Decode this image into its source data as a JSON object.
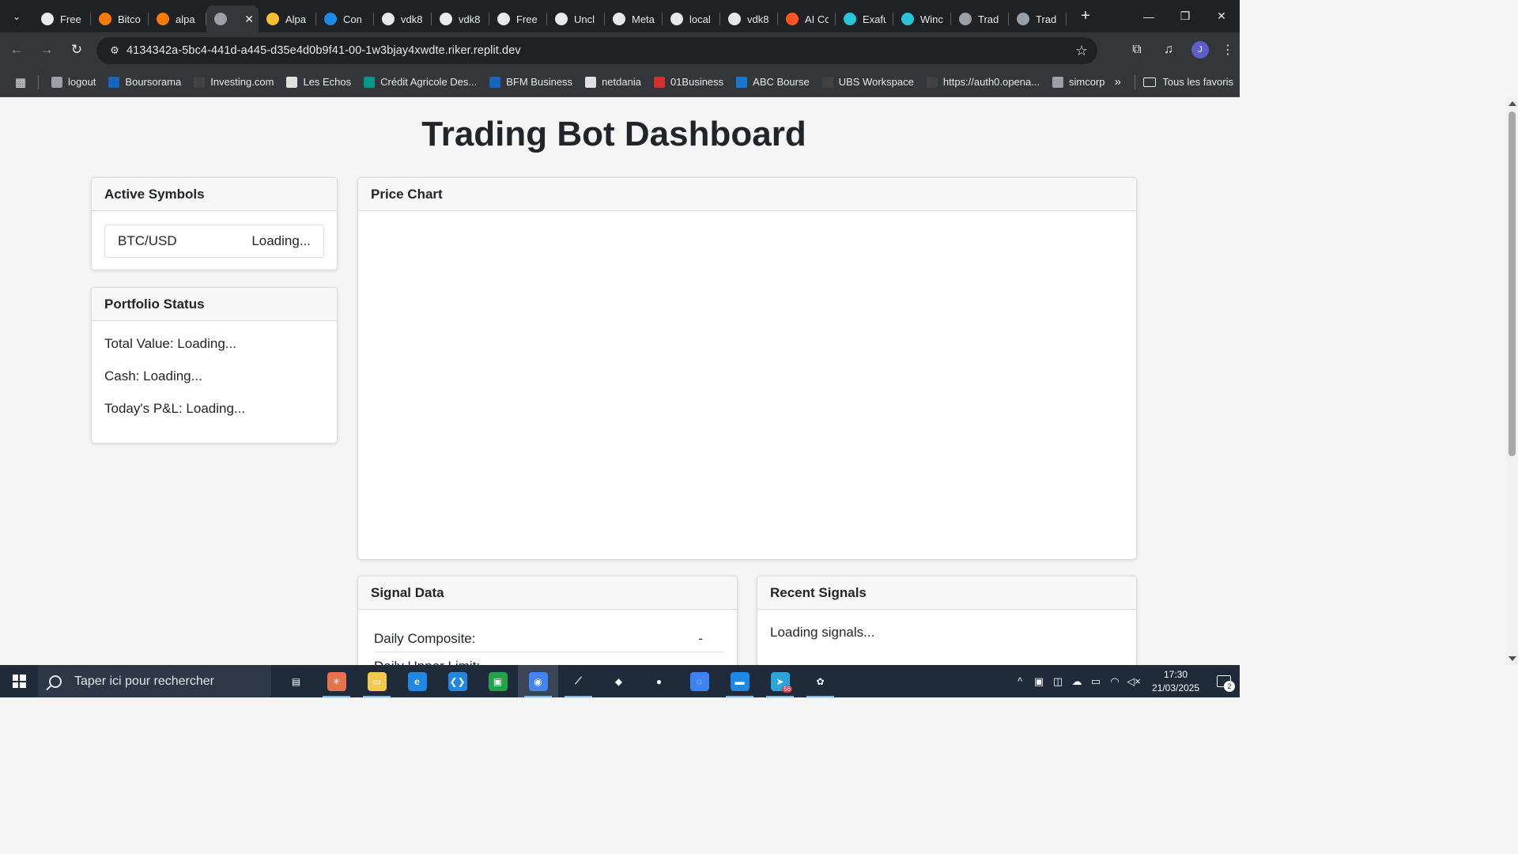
{
  "browser": {
    "tabs": [
      {
        "label": "Free",
        "favicon_color": "#e8eaed",
        "icon": "bear-icon"
      },
      {
        "label": "Bitco",
        "favicon_color": "#f57c00",
        "icon": "diamond-icon"
      },
      {
        "label": "alpa",
        "favicon_color": "#f57c00",
        "icon": "diamond-icon"
      },
      {
        "label": "",
        "favicon_color": "#9aa0a6",
        "icon": "globe-icon",
        "active": true
      },
      {
        "label": "Alpa",
        "favicon_color": "#fbc02d",
        "icon": "square-icon"
      },
      {
        "label": "Con",
        "favicon_color": "#1e88e5",
        "icon": "paypal-icon"
      },
      {
        "label": "vdk8",
        "favicon_color": "#e8eaed",
        "icon": "github-icon"
      },
      {
        "label": "vdk8",
        "favicon_color": "#e8eaed",
        "icon": "github-icon"
      },
      {
        "label": "Free",
        "favicon_color": "#e8eaed",
        "icon": "bear-icon"
      },
      {
        "label": "Uncl",
        "favicon_color": "#e8eaed",
        "icon": "doc-icon"
      },
      {
        "label": "Meta",
        "favicon_color": "#e8eaed",
        "icon": "doc-icon"
      },
      {
        "label": "local",
        "favicon_color": "#e8eaed",
        "icon": "bear-icon"
      },
      {
        "label": "vdk8",
        "favicon_color": "#e8eaed",
        "icon": "github-icon"
      },
      {
        "label": "AI Co",
        "favicon_color": "#ff5722",
        "icon": "reddit-icon"
      },
      {
        "label": "Exafu",
        "favicon_color": "#26c6da",
        "icon": "bracket-icon"
      },
      {
        "label": "Winc",
        "favicon_color": "#26c6da",
        "icon": "bracket-icon"
      },
      {
        "label": "Trad",
        "favicon_color": "#9aa0a6",
        "icon": "globe-icon"
      },
      {
        "label": "Trad",
        "favicon_color": "#9aa0a6",
        "icon": "globe-icon"
      }
    ],
    "url": "4134342a-5bc4-441d-a445-d35e4d0b9f41-00-1w3bjay4xwdte.riker.replit.dev",
    "avatar_letter": "J",
    "bookmarks": [
      {
        "label": "logout",
        "color": "#9aa0a6"
      },
      {
        "label": "Boursorama",
        "color": "#1565c0"
      },
      {
        "label": "Investing.com",
        "color": "#424242"
      },
      {
        "label": "Les Echos",
        "color": "#e0e0e0"
      },
      {
        "label": "Crédit Agricole Des...",
        "color": "#009688"
      },
      {
        "label": "BFM Business",
        "color": "#1565c0"
      },
      {
        "label": "netdania",
        "color": "#e0e0e0"
      },
      {
        "label": "01Business",
        "color": "#d32f2f"
      },
      {
        "label": "ABC Bourse",
        "color": "#1976d2"
      },
      {
        "label": "UBS Workspace",
        "color": "#424242"
      },
      {
        "label": "https://auth0.opena...",
        "color": "#424242"
      },
      {
        "label": "simcorp",
        "color": "#9aa0a6"
      }
    ],
    "all_bookmarks_label": "Tous les favoris"
  },
  "page": {
    "title": "Trading Bot Dashboard",
    "active_symbols": {
      "header": "Active Symbols",
      "items": [
        {
          "symbol": "BTC/USD",
          "status": "Loading..."
        }
      ]
    },
    "portfolio": {
      "header": "Portfolio Status",
      "total_value": "Total Value: Loading...",
      "cash": "Cash: Loading...",
      "pnl": "Today's P&L: Loading..."
    },
    "price_chart": {
      "header": "Price Chart"
    },
    "signal_data": {
      "header": "Signal Data",
      "rows": [
        {
          "label": "Daily Composite:",
          "value": "-"
        },
        {
          "label": "Daily Upper Limit:",
          "value": "-"
        }
      ]
    },
    "recent_signals": {
      "header": "Recent Signals",
      "text": "Loading signals..."
    }
  },
  "taskbar": {
    "search_placeholder": "Taper ici pour rechercher",
    "apps": [
      {
        "name": "task-view-icon",
        "color": "#1f2a3a"
      },
      {
        "name": "claude-icon",
        "color": "#e8734a"
      },
      {
        "name": "file-explorer-icon",
        "color": "#f2c94c"
      },
      {
        "name": "edge-icon",
        "color": "#1e88e5"
      },
      {
        "name": "vscode-icon",
        "color": "#1e88e5"
      },
      {
        "name": "terminal-icon",
        "color": "#22a34a"
      },
      {
        "name": "chrome-icon",
        "color": "#4285f4"
      },
      {
        "name": "app-icon",
        "color": "#1f2a3a"
      },
      {
        "name": "cube-icon",
        "color": "#1f2a3a"
      },
      {
        "name": "github-icon",
        "color": "#1f2a3a"
      },
      {
        "name": "swirl-icon",
        "color": "#3b82f6"
      },
      {
        "name": "monitor-icon",
        "color": "#1e88e5"
      },
      {
        "name": "telegram-icon",
        "color": "#2aa3df"
      },
      {
        "name": "chatgpt-icon",
        "color": "#1f2a3a"
      }
    ],
    "telegram_badge": "56",
    "time": "17:30",
    "date": "21/03/2025",
    "notifications": "2"
  }
}
